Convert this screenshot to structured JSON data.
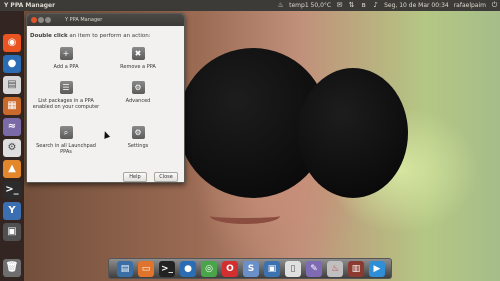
{
  "top_panel": {
    "active_app": "Y PPA Manager",
    "temperature": "temp1 50,0°C",
    "datetime": "Seg, 10 de Mar 00:34",
    "user": "rafaelpaim",
    "tray_icons": [
      "thermometer-icon",
      "mail-icon",
      "network-icon",
      "bluetooth-icon",
      "volume-icon",
      "power-icon"
    ]
  },
  "window": {
    "title": "Y PPA Manager",
    "instruction_bold": "Double click",
    "instruction_rest": " an item to perform an action:",
    "tiles": [
      {
        "label": "Add a PPA",
        "icon": "add-icon",
        "glyph": "+"
      },
      {
        "label": "Remove a PPA",
        "icon": "remove-icon",
        "glyph": "✖"
      },
      {
        "label": "List packages in a PPA enabled on your computer",
        "icon": "list-icon",
        "glyph": "☰"
      },
      {
        "label": "Advanced",
        "icon": "advanced-icon",
        "glyph": "⚙"
      },
      {
        "label": "Search in all Launchpad PPAs",
        "icon": "search-icon",
        "glyph": "⌕"
      },
      {
        "label": "Settings",
        "icon": "settings-icon",
        "glyph": "⚙"
      }
    ],
    "help_label": "Help",
    "close_label": "Close"
  },
  "colors": {
    "panel": "#3c3b37",
    "close_button": "#e0542b",
    "window_bg": "#f2f1f0"
  }
}
